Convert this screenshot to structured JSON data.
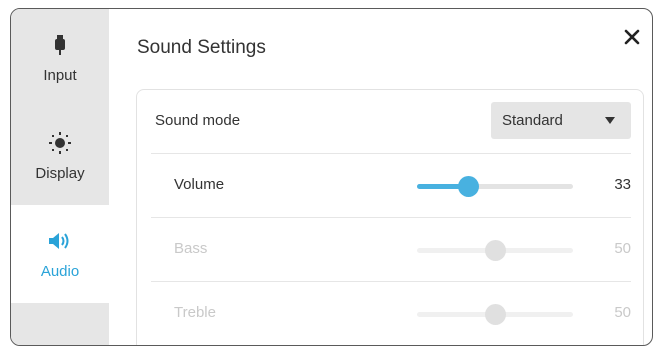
{
  "sidebar": {
    "items": [
      {
        "label": "Input",
        "icon": "plug-icon"
      },
      {
        "label": "Display",
        "icon": "brightness-icon"
      },
      {
        "label": "Audio",
        "icon": "speaker-icon"
      }
    ],
    "active_index": 2
  },
  "main": {
    "title": "Sound Settings",
    "sound_mode": {
      "label": "Sound mode",
      "value": "Standard"
    },
    "sliders": [
      {
        "label": "Volume",
        "value": "33",
        "fraction": 0.33,
        "enabled": true
      },
      {
        "label": "Bass",
        "value": "50",
        "fraction": 0.5,
        "enabled": false
      },
      {
        "label": "Treble",
        "value": "50",
        "fraction": 0.5,
        "enabled": false
      }
    ]
  },
  "colors": {
    "accent": "#2aa3d8",
    "slider_active": "#48b1e0",
    "sidebar_bg": "#e6e6e6"
  }
}
